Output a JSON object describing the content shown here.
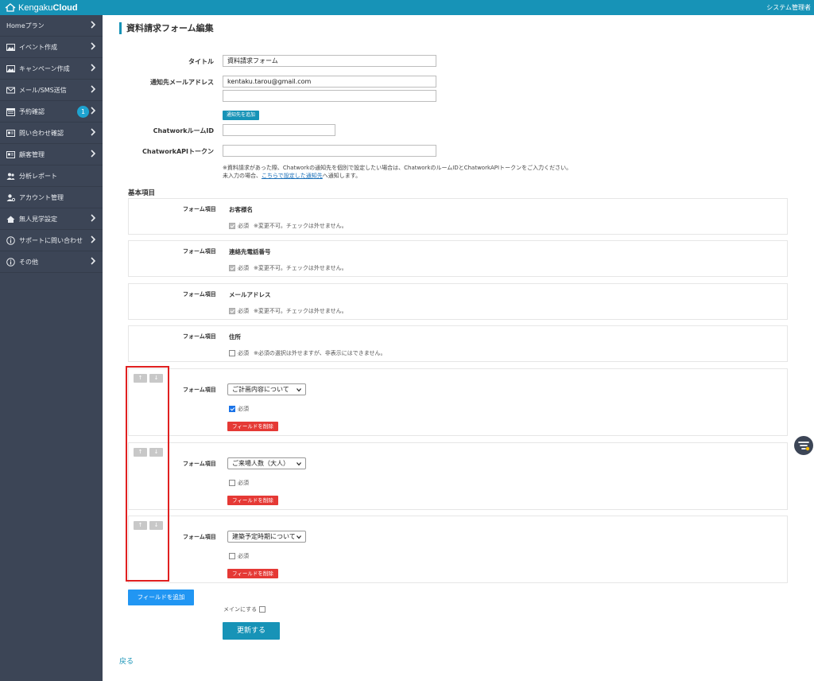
{
  "app": {
    "brand_light": "Kengaku",
    "brand_bold": "Cloud",
    "top_right": "システム管理者"
  },
  "sidebar": {
    "items": [
      {
        "label": "Homeプラン",
        "icon": "none",
        "chevron": true
      },
      {
        "label": "イベント作成",
        "icon": "image-icon",
        "chevron": true
      },
      {
        "label": "キャンペーン作成",
        "icon": "image-icon",
        "chevron": true
      },
      {
        "label": "メール/SMS送信",
        "icon": "envelope-icon",
        "chevron": true
      },
      {
        "label": "予約確認",
        "icon": "calendar-icon",
        "chevron": true,
        "badge": "1"
      },
      {
        "label": "問い合わせ確認",
        "icon": "id-card-icon",
        "chevron": true
      },
      {
        "label": "顧客管理",
        "icon": "id-card-icon",
        "chevron": true
      },
      {
        "label": "分析レポート",
        "icon": "users-icon",
        "chevron": false
      },
      {
        "label": "アカウント管理",
        "icon": "user-gear-icon",
        "chevron": false
      },
      {
        "label": "無人見学設定",
        "icon": "home-icon",
        "chevron": true
      },
      {
        "label": "サポートに問い合わせ",
        "icon": "info-circle-icon",
        "chevron": true
      },
      {
        "label": "その他",
        "icon": "info-circle-icon",
        "chevron": true
      }
    ]
  },
  "page": {
    "title": "資料請求フォーム編集",
    "back_label": "戻る"
  },
  "form": {
    "title_label": "タイトル",
    "title_value": "資料請求フォーム",
    "email_label": "通知先メールアドレス",
    "email_value_1": "kentaku.tarou@gmail.com",
    "email_value_2": "",
    "add_recipient_label": "通知先を追加",
    "chatwork_room_label": "ChatworkルームID",
    "chatwork_room_value": "",
    "chatwork_token_label": "ChatworkAPIトークン",
    "chatwork_token_value": "",
    "note_line_1": "※資料請求があった際、Chatworkの通知先を個別で設定したい場合は、ChatworkのルームIDとChatworkAPIトークンをご入力ください。",
    "note_line_2_pre": "未入力の場合、",
    "note_line_2_link": "こちらで設定した通知先",
    "note_line_2_post": "へ通知します。"
  },
  "basic": {
    "section_title": "基本項目",
    "field_label": "フォーム項目",
    "required_label": "必須",
    "items": [
      {
        "name": "お客様名",
        "note": "※変更不可。チェックは外せません。"
      },
      {
        "name": "連絡先電話番号",
        "note": "※変更不可。チェックは外せません。"
      },
      {
        "name": "メールアドレス",
        "note": "※変更不可。チェックは外せません。"
      },
      {
        "name": "住所",
        "note": "※必須の選択は外せますが、非表示にはできません。"
      }
    ]
  },
  "custom": {
    "field_label": "フォーム項目",
    "required_label": "必須",
    "delete_label": "フィールドを削除",
    "up_arrow": "↑",
    "down_arrow": "↓",
    "items": [
      {
        "selected": "ご計画内容について",
        "required": true
      },
      {
        "selected": "ご来場人数（大人）",
        "required": false
      },
      {
        "selected": "建築予定時期について",
        "required": false
      }
    ]
  },
  "actions": {
    "add_field_label": "フィールドを追加",
    "main_label": "メインにする",
    "update_label": "更新する"
  },
  "colors": {
    "accent": "#1793b7",
    "sidebar_bg": "#3c4556",
    "danger": "#e53935",
    "highlight": "#e02020"
  }
}
